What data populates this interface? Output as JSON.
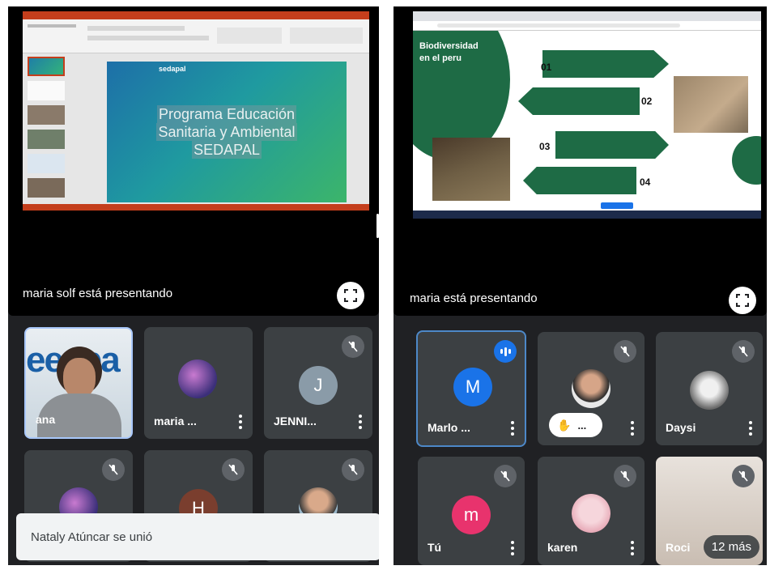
{
  "left": {
    "presenting_label": "maria solf está presentando",
    "slide": {
      "title_line1": "Programa Educación",
      "title_line2": "Sanitaria y Ambiental",
      "title_line3": "SEDAPAL",
      "brand": "sedapal"
    },
    "participants": [
      {
        "name": "ana"
      },
      {
        "name": "maria ..."
      },
      {
        "name": "JENNI...",
        "initial": "J"
      },
      {
        "name": ""
      },
      {
        "name": "",
        "initial": "H"
      },
      {
        "name": ""
      }
    ],
    "toast": "Nataly Atúncar se unió"
  },
  "right": {
    "presenting_label": "maria está presentando",
    "slide": {
      "title_line1": "Biodiversidad",
      "title_line2": "en el peru",
      "steps": [
        "01",
        "02",
        "03",
        "04"
      ]
    },
    "participants": [
      {
        "name": "Marlo ...",
        "initial": "M"
      },
      {
        "name": "",
        "raise_hand": "..."
      },
      {
        "name": "Daysi"
      },
      {
        "name": "Tú",
        "initial": "m"
      },
      {
        "name": "karen"
      },
      {
        "name": "Roci",
        "more": "12 más"
      }
    ]
  },
  "colors": {
    "tile_bg": "#3c4043",
    "app_bg": "#202124",
    "accent_blue": "#1a73e8",
    "pink": "#e8336d",
    "slide_green": "#1e6b45"
  }
}
